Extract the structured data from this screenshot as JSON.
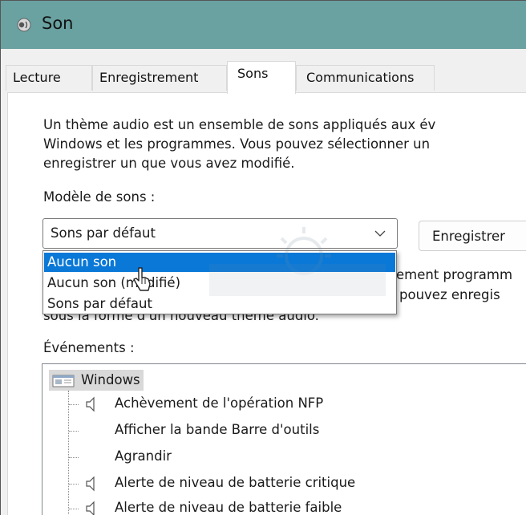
{
  "window": {
    "title": "Son"
  },
  "tabs": [
    {
      "label": "Lecture"
    },
    {
      "label": "Enregistrement"
    },
    {
      "label": "Sons"
    },
    {
      "label": "Communications"
    }
  ],
  "sons": {
    "description": [
      "Un thème audio est un ensemble de sons appliqués aux év",
      "Windows et les programmes. Vous pouvez sélectionner un",
      "enregistrer un que vous avez modifié."
    ],
    "scheme_label": "Modèle de sons :",
    "scheme_selected": "Sons par défaut",
    "save_button": "Enregistrer",
    "dropdown_options": [
      "Aucun son",
      "Aucun son (modifié)",
      "Sons par défaut"
    ],
    "behind_text": [
      "ement programm",
      "pouvez enregis",
      "sous la forme d'un nouveau thème audio."
    ],
    "events_label": "Événements :",
    "events_root": "Windows",
    "events": [
      {
        "label": "Achèvement de l'opération NFP",
        "icon": "speaker-icon"
      },
      {
        "label": "Afficher la bande Barre d'outils",
        "icon": ""
      },
      {
        "label": "Agrandir",
        "icon": ""
      },
      {
        "label": "Alerte de niveau de batterie critique",
        "icon": "speaker-icon"
      },
      {
        "label": "Alerte de niveau de batterie faible",
        "icon": "speaker-icon"
      }
    ]
  },
  "colors": {
    "titlebar": "#6aa1a1",
    "selection": "#0a78d7"
  }
}
